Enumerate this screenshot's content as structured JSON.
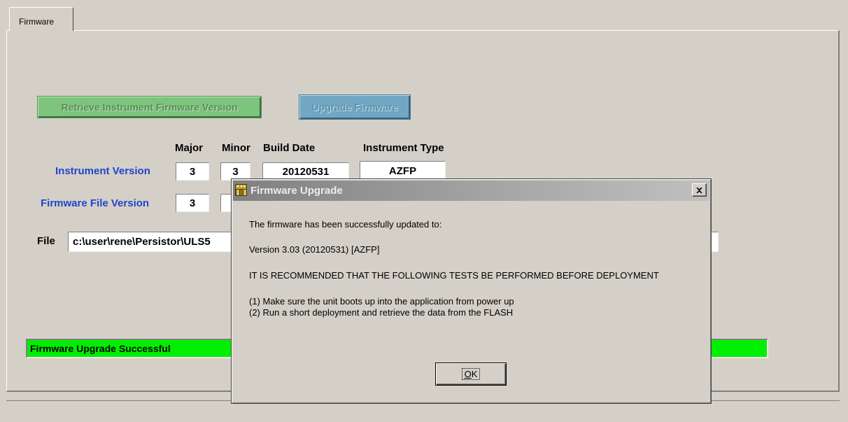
{
  "tab": {
    "label": "Firmware"
  },
  "buttons": {
    "retrieve": "Retrieve Instrument Firmware Version",
    "upgrade": "Upgrade Firmware"
  },
  "headers": {
    "major": "Major",
    "minor": "Minor",
    "build_date": "Build Date",
    "instrument_type": "Instrument Type"
  },
  "instrument_version": {
    "label": "Instrument Version",
    "major": "3",
    "minor": "3",
    "build_date": "20120531",
    "type": "AZFP"
  },
  "firmware_file_version": {
    "label": "Firmware File Version",
    "major": "3",
    "minor": ""
  },
  "file": {
    "label": "File",
    "value": "c:\\user\\rene\\Persistor\\ULS5"
  },
  "status": {
    "text": "Firmware Upgrade Successful",
    "color": "#00f000"
  },
  "dialog": {
    "title": "Firmware Upgrade",
    "close_glyph": "×",
    "line1": "The firmware has been successfully updated to:",
    "line2": "Version 3.03 (20120531) [AZFP]",
    "line3": "IT IS RECOMMENDED THAT THE FOLLOWING TESTS BE PERFORMED BEFORE DEPLOYMENT",
    "line4": "(1) Make sure the unit boots up into the application from power up",
    "line5": "(2) Run a short deployment and retrieve the data from the FLASH",
    "ok_label": "OK"
  }
}
